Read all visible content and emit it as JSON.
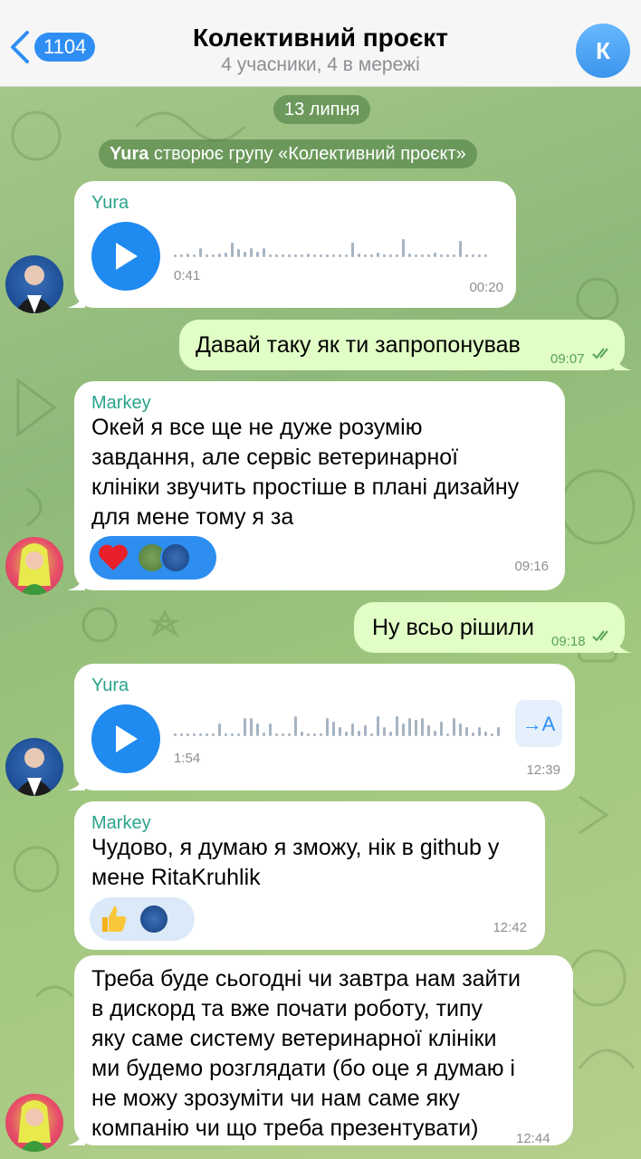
{
  "header": {
    "back_count": "1104",
    "title": "Колективний проєкт",
    "subtitle": "4 учасники, 4 в мережі",
    "avatar_letter": "К"
  },
  "date_pill": "13 липня",
  "service": {
    "actor": "Yura",
    "action": " створює групу «Колективний проєкт»"
  },
  "messages": [
    {
      "type": "voice",
      "direction": "in",
      "sender": "Yura",
      "duration": "0:41",
      "time": "00:20"
    },
    {
      "type": "text",
      "direction": "out",
      "text": "Давай таку як ти запропонував",
      "time": "09:07"
    },
    {
      "type": "text",
      "direction": "in",
      "sender": "Markey",
      "text": "Окей я все ще не дуже розумію\nзавдання, але сервіс ветеринарної\nклініки звучить простіше в плані дизайну\nдля мене тому я за",
      "reaction": "heart",
      "time": "09:16"
    },
    {
      "type": "text",
      "direction": "out",
      "text": "Ну всьо рішили",
      "time": "09:18"
    },
    {
      "type": "voice",
      "direction": "in",
      "sender": "Yura",
      "duration": "1:54",
      "transcribe_label": "→A",
      "time": "12:39"
    },
    {
      "type": "text",
      "direction": "in",
      "sender": "Markey",
      "text": "Чудово, я думаю я зможу, нік в github у\nмене RitaKruhlik",
      "reaction": "thumbs-up",
      "time": "12:42"
    },
    {
      "type": "text",
      "direction": "in",
      "text": "Треба буде сьогодні чи завтра нам зайти\nв дискорд та вже почати роботу, типу\nяку саме систему ветеринарної клініки\nми будемо розглядати (бо оце я думаю і\nне можу зрозуміти чи нам саме яку\nкомпанію чи що треба презентувати)",
      "time": "12:44"
    }
  ],
  "colors": {
    "accent": "#2f8ef4",
    "outgoing_bubble": "#e1fec6",
    "sender_name": "#2aa38c"
  }
}
